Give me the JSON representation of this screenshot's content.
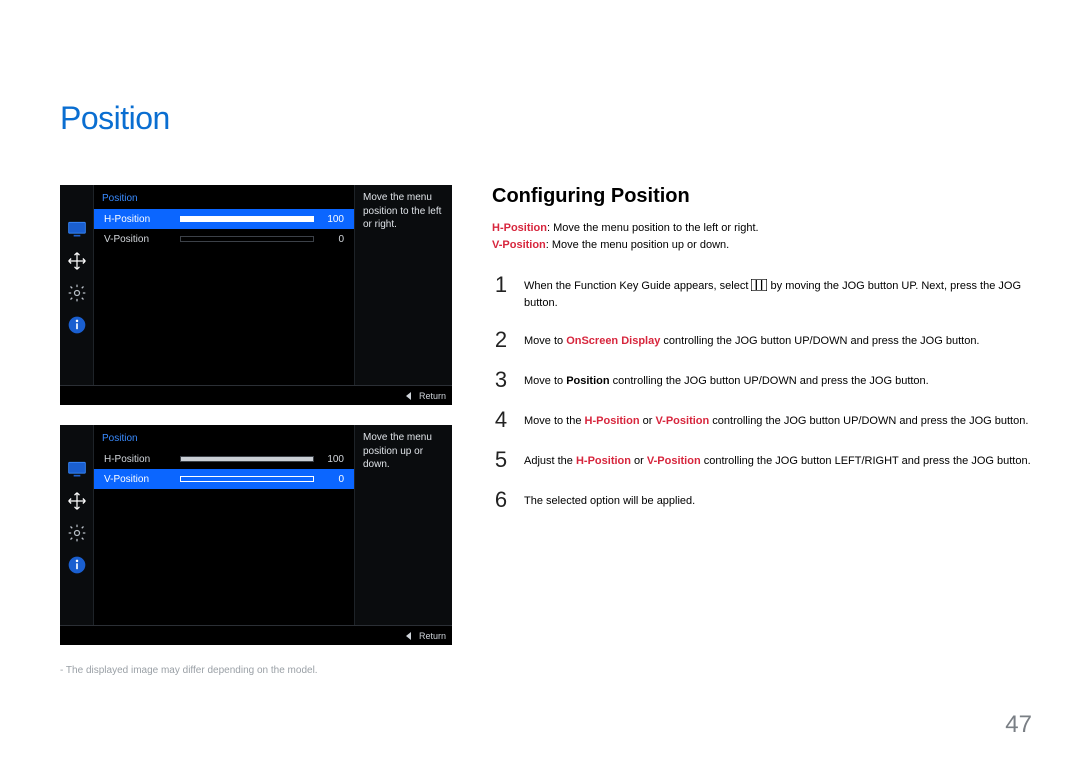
{
  "title": "Position",
  "section_title": "Configuring Position",
  "h_def_term": "H-Position",
  "h_def_text": ": Move the menu position to the left or right.",
  "v_def_term": "V-Position",
  "v_def_text": ": Move the menu position up or down.",
  "steps": {
    "s1a": "When the Function Key Guide appears, select ",
    "s1b": " by moving the JOG button UP. Next, press the JOG button.",
    "s2a": "Move to ",
    "s2b": "OnScreen Display",
    "s2c": " controlling the JOG button UP/DOWN and press the JOG button.",
    "s3a": "Move to ",
    "s3b": "Position",
    "s3c": " controlling the JOG button UP/DOWN and press the JOG button.",
    "s4a": "Move to the ",
    "s4b": "H-Position",
    "s4c": " or ",
    "s4d": "V-Position",
    "s4e": " controlling the JOG button UP/DOWN and press the JOG button.",
    "s5a": "Adjust the ",
    "s5b": "H-Position",
    "s5c": " or ",
    "s5d": "V-Position",
    "s5e": " controlling the JOG button LEFT/RIGHT and press the JOG button.",
    "s6": "The selected option will be applied."
  },
  "step_nums": {
    "n1": "1",
    "n2": "2",
    "n3": "3",
    "n4": "4",
    "n5": "5",
    "n6": "6"
  },
  "footnote": "-  The displayed image may differ depending on the model.",
  "osd": {
    "title": "Position",
    "h_label": "H-Position",
    "v_label": "V-Position",
    "h_val": "100",
    "v_val": "0",
    "hint_h": "Move the menu position to the left or right.",
    "hint_v": "Move the menu position up or down.",
    "return": "Return"
  },
  "page_num": "47"
}
